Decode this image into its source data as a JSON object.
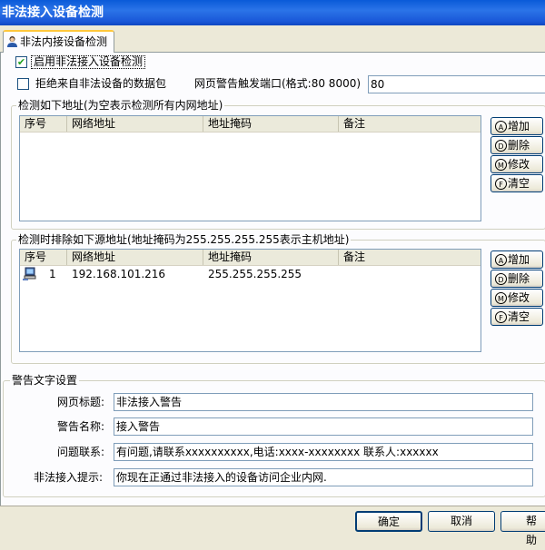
{
  "window": {
    "title": "非法接入设备检测"
  },
  "tab": {
    "label": "非法内接设备检测"
  },
  "options": {
    "enable_label": "启用非法接入设备检测",
    "enable_checked": true,
    "reject_label": "拒绝来自非法设备的数据包",
    "reject_checked": false,
    "port_label": "网页警告触发端口(格式:80 8000)",
    "port_value": "80"
  },
  "detect_group": {
    "legend": "检测如下地址(为空表示检测所有内网地址)",
    "columns": [
      "序号",
      "网络地址",
      "地址掩码",
      "备注"
    ],
    "rows": []
  },
  "exclude_group": {
    "legend": "检测时排除如下源地址(地址掩码为255.255.255.255表示主机地址)",
    "columns": [
      "序号",
      "网络地址",
      "地址掩码",
      "备注"
    ],
    "rows": [
      {
        "index": "1",
        "network": "192.168.101.216",
        "mask": "255.255.255.255",
        "note": "",
        "icon": "computer-icon"
      }
    ]
  },
  "side_buttons": [
    {
      "key": "A",
      "label": "增加"
    },
    {
      "key": "D",
      "label": "删除"
    },
    {
      "key": "M",
      "label": "修改"
    },
    {
      "key": "F",
      "label": "清空"
    }
  ],
  "warning_group": {
    "legend": "警告文字设置",
    "page_title_label": "网页标题:",
    "page_title_value": "非法接入警告",
    "warning_name_label": "警告名称:",
    "warning_name_value": "接入警告",
    "contact_label": "问题联系:",
    "contact_value": "有问题,请联系xxxxxxxxxx,电话:xxxx-xxxxxxxx 联系人:xxxxxx",
    "prompt_label": "非法接入提示:",
    "prompt_value": "你现在正通过非法接入的设备访问企业内网."
  },
  "footer": {
    "ok": "确定",
    "cancel": "取消",
    "help": "帮助"
  },
  "colors": {
    "titlebar": "#0a5ad8",
    "face": "#ece9d8",
    "panel": "#fcfcfe",
    "tab_highlight": "#ffc83c"
  }
}
